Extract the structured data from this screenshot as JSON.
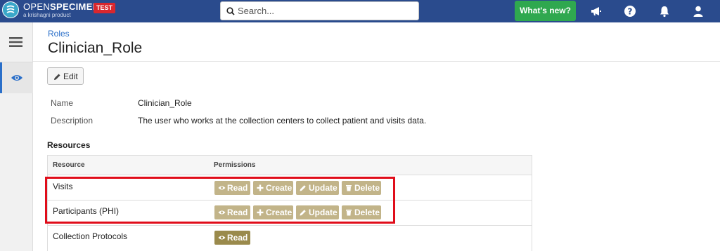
{
  "navbar": {
    "brand_bold": "OPEN",
    "brand_rest": "SPECIMEN",
    "brand_sub": "a krishagni product",
    "env_badge": "TEST",
    "search_placeholder": "Search...",
    "whats_new": "What's new?",
    "icons": [
      "megaphone-icon",
      "help-icon",
      "bell-icon",
      "user-icon"
    ],
    "bg_color": "#2a4b8d",
    "accent_green": "#2fa84f"
  },
  "sidebar": {
    "icons": [
      "menu-icon",
      "eye-icon"
    ]
  },
  "header": {
    "breadcrumb": "Roles",
    "title": "Clinician_Role",
    "edit_label": "Edit"
  },
  "overview": {
    "name_label": "Name",
    "name_value": "Clinician_Role",
    "description_label": "Description",
    "description_value": "The user who works at the collection centers to collect patient and visits data."
  },
  "resources": {
    "title": "Resources",
    "col_resource": "Resource",
    "col_permissions": "Permissions",
    "rows": [
      {
        "name": "Visits",
        "permissions": [
          "Read",
          "Create",
          "Update",
          "Delete"
        ]
      },
      {
        "name": "Participants (PHI)",
        "permissions": [
          "Read",
          "Create",
          "Update",
          "Delete"
        ]
      },
      {
        "name": "Collection Protocols",
        "permissions": [
          "Read"
        ]
      }
    ]
  },
  "colors": {
    "permission_badge": "#c2b489",
    "permission_badge_active": "#9a8a4c",
    "highlight_border": "#e00d1a"
  }
}
